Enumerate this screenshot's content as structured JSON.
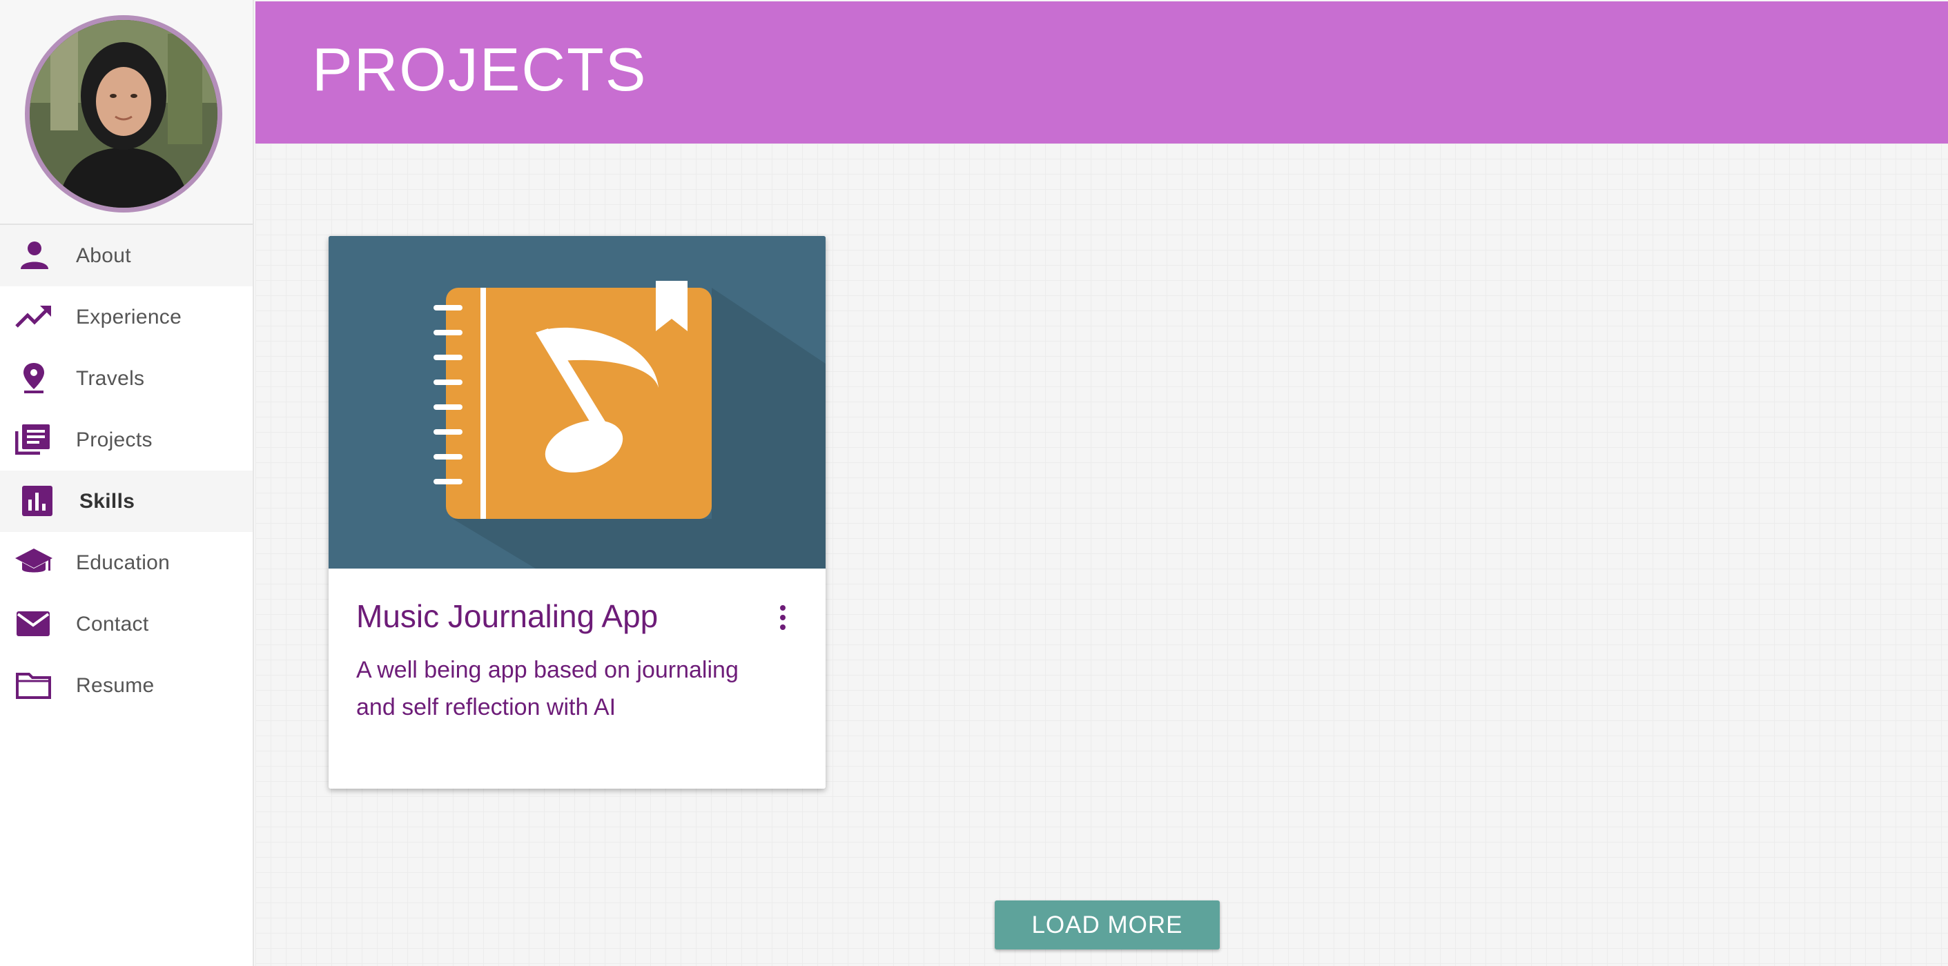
{
  "sidebar": {
    "items": [
      {
        "label": "About",
        "icon": "person-icon"
      },
      {
        "label": "Experience",
        "icon": "trending-up-icon"
      },
      {
        "label": "Travels",
        "icon": "location-pin-icon"
      },
      {
        "label": "Projects",
        "icon": "library-books-icon"
      },
      {
        "label": "Skills",
        "icon": "bar-chart-icon"
      },
      {
        "label": "Education",
        "icon": "graduation-cap-icon"
      },
      {
        "label": "Contact",
        "icon": "mail-icon"
      },
      {
        "label": "Resume",
        "icon": "folder-icon"
      }
    ]
  },
  "header": {
    "title": "PROJECTS"
  },
  "project": {
    "title": "Music Journaling App",
    "description": "A well being app based on journaling and self reflection with AI",
    "icon": "music-notebook-icon"
  },
  "load_more": "LOAD MORE",
  "colors": {
    "header": "#c86ed1",
    "accent": "#6d1c78",
    "button": "#5ea39b",
    "card_media": "#426a80",
    "notebook": "#e89c3a"
  }
}
